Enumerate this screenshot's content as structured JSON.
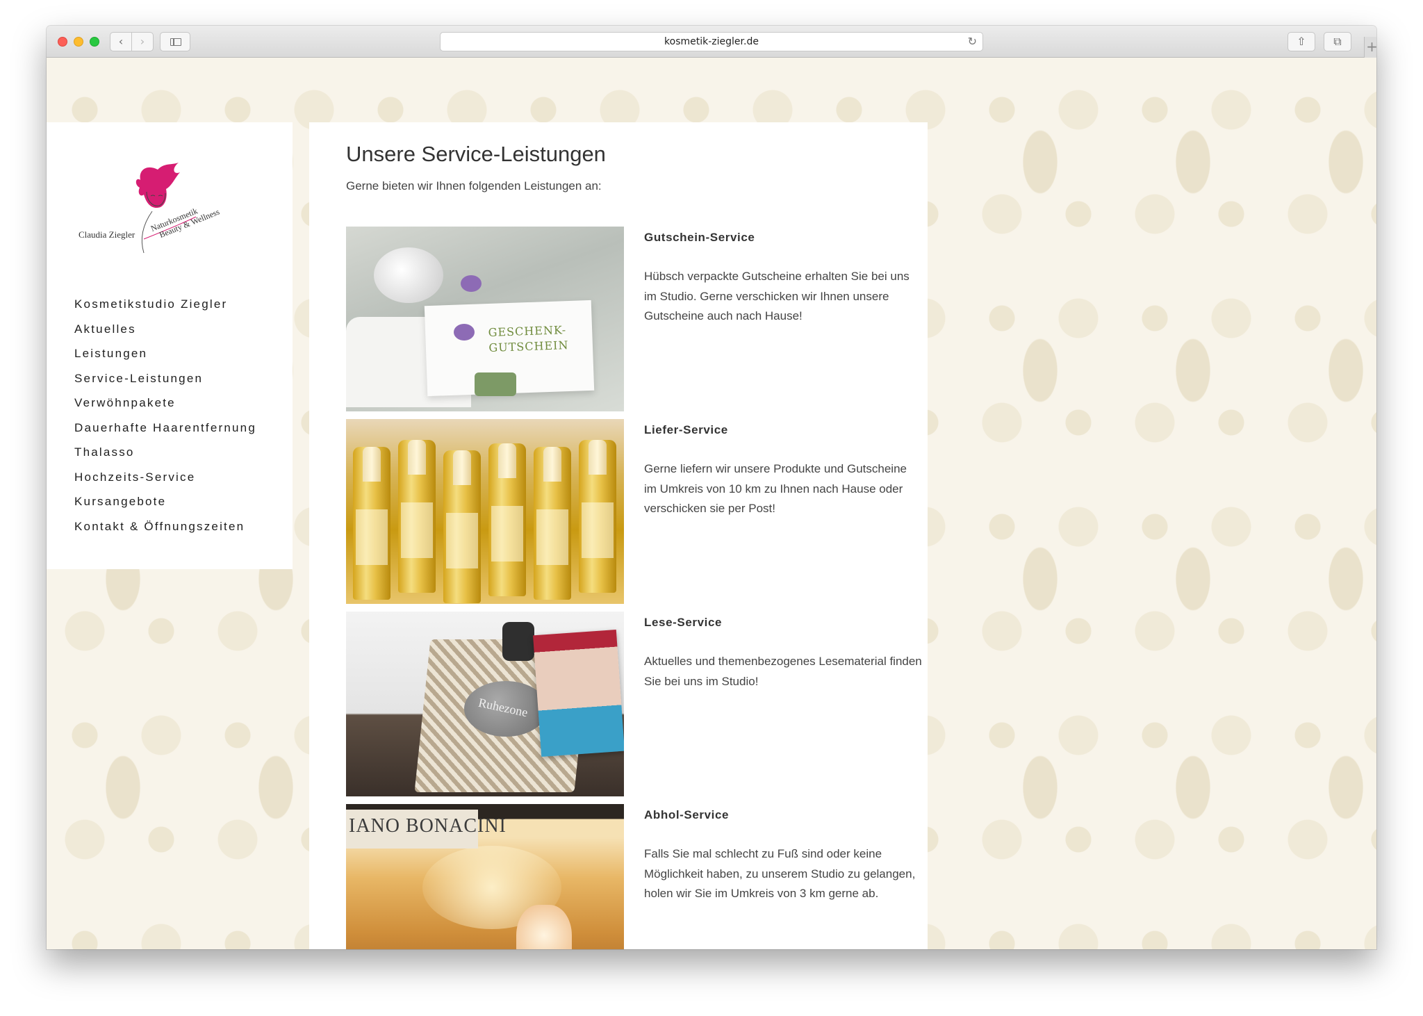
{
  "browser": {
    "url": "kosmetik-ziegler.de",
    "back_glyph": "‹",
    "forward_glyph": "›",
    "reload_glyph": "↻",
    "share_glyph": "⇧",
    "tabs_glyph": "⧉",
    "new_tab_glyph": "+"
  },
  "logo": {
    "name": "Claudia Ziegler",
    "tagline_1": "Naturkosmetik",
    "tagline_2": "Beauty & Wellness",
    "accent_color": "#d61d72"
  },
  "nav": {
    "items": [
      "Kosmetikstudio Ziegler",
      "Aktuelles",
      "Leistungen",
      "Service-Leistungen",
      "Verwöhnpakete",
      "Dauerhafte Haarentfernung",
      "Thalasso",
      "Hochzeits-Service",
      "Kursangebote",
      "Kontakt & Öffnungszeiten"
    ]
  },
  "main": {
    "title": "Unsere Service-Leistungen",
    "intro": "Gerne bieten wir Ihnen folgenden Leistungen an:",
    "services": [
      {
        "title": "Gutschein-Service",
        "text": "Hübsch verpackte Gutscheine erhalten Sie bei uns im Studio. Gerne verschicken wir Ihnen unsere Gutscheine auch nach Hause!",
        "photo_text": "GESCHENK-\nGUTSCHEIN"
      },
      {
        "title": "Liefer-Service",
        "text": "Gerne liefern wir unsere Produkte und Gutscheine im Umkreis von 10 km zu Ihnen nach Hause oder verschicken sie per Post!"
      },
      {
        "title": "Lese-Service",
        "text": "Aktuelles und themenbezogenes Lesematerial finden Sie bei uns im Studio!",
        "photo_text": "Ruhezone"
      },
      {
        "title": "Abhol-Service",
        "text": "Falls Sie mal schlecht zu Fuß sind oder keine Möglichkeit haben, zu unserem Studio zu gelangen, holen wir Sie im Umkreis von 3 km gerne ab.",
        "photo_text": "IANO BONACINI"
      }
    ]
  }
}
